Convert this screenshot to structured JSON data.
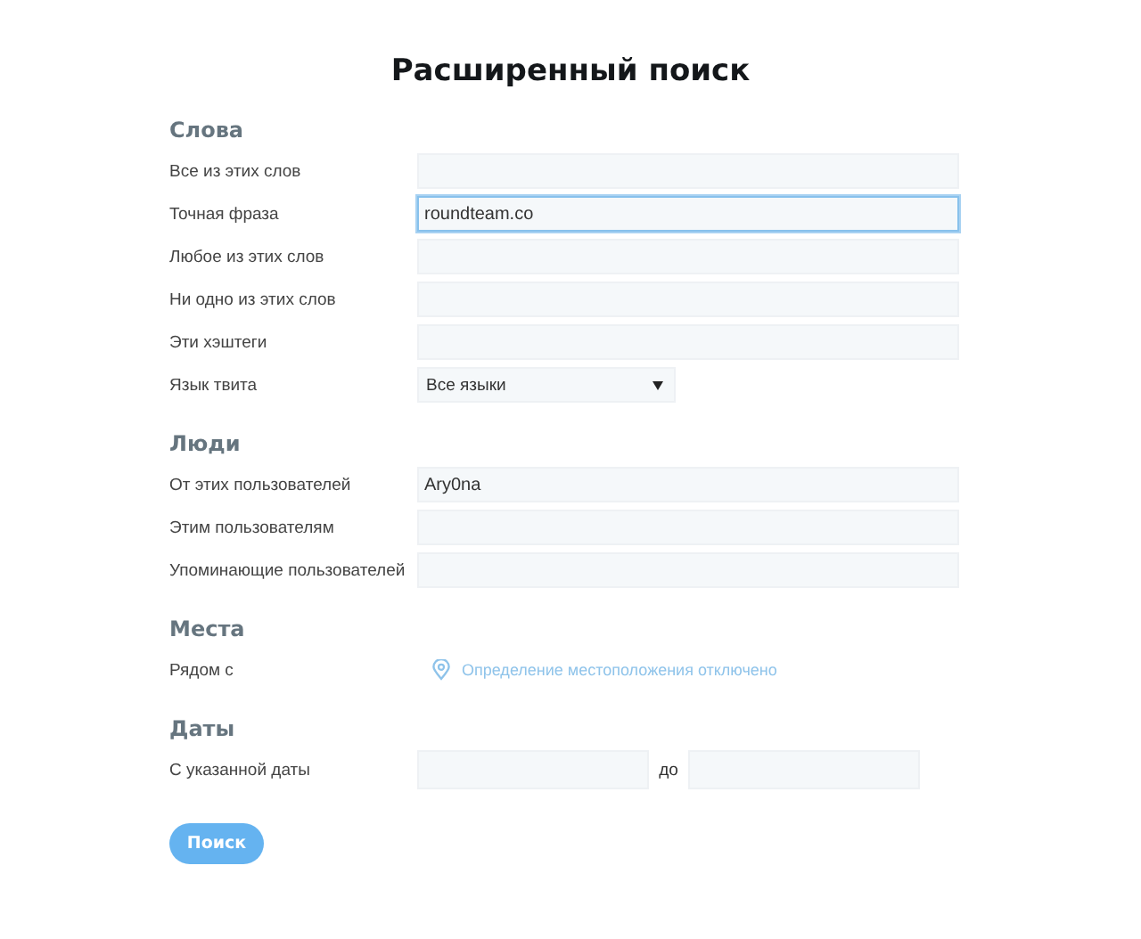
{
  "title": "Расширенный поиск",
  "sections": [
    {
      "heading": "Слова",
      "rows": [
        {
          "kind": "text",
          "label": "Все из этих слов"
        },
        {
          "kind": "text",
          "label": "Точная фраза",
          "value": "roundteam.co",
          "focused": true
        },
        {
          "kind": "text",
          "label": "Любое из этих слов"
        },
        {
          "kind": "text",
          "label": "Ни одно из этих слов"
        },
        {
          "kind": "text",
          "label": "Эти хэштеги"
        },
        {
          "kind": "select",
          "label": "Язык твита",
          "value": "Все языки"
        }
      ]
    },
    {
      "heading": "Люди",
      "rows": [
        {
          "kind": "text",
          "label": "От этих пользователей",
          "value": "Ary0na"
        },
        {
          "kind": "text",
          "label": "Этим пользователям"
        },
        {
          "kind": "text",
          "label": "Упоминающие пользователей"
        }
      ]
    },
    {
      "heading": "Места",
      "rows": [
        {
          "kind": "location",
          "label": "Рядом с",
          "value": "Определение местоположения отключено"
        }
      ]
    },
    {
      "heading": "Даты",
      "rows": [
        {
          "kind": "daterange",
          "label": "С указанной даты",
          "separator": "до"
        }
      ]
    }
  ],
  "button": "Поиск"
}
